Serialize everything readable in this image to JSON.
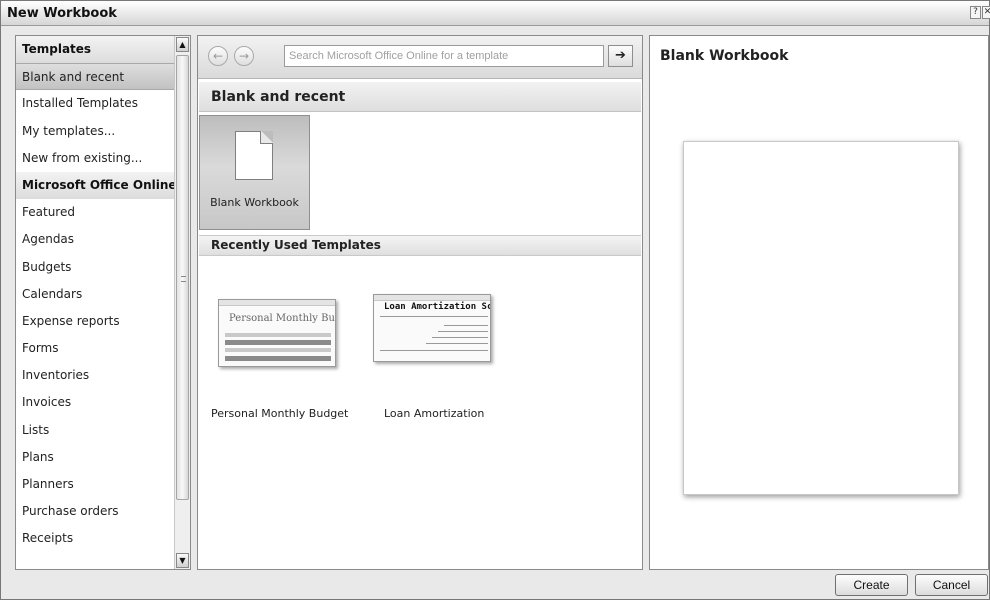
{
  "window": {
    "title": "New Workbook",
    "help_glyph": "?",
    "close_glyph": "✕"
  },
  "sidebar": {
    "items": [
      {
        "label": "Templates",
        "kind": "header"
      },
      {
        "label": "Blank and recent",
        "kind": "item",
        "selected": true
      },
      {
        "label": "Installed Templates",
        "kind": "item"
      },
      {
        "label": "My templates...",
        "kind": "item"
      },
      {
        "label": "New from existing...",
        "kind": "item"
      },
      {
        "label": "Microsoft Office Online",
        "kind": "header"
      },
      {
        "label": "Featured",
        "kind": "item"
      },
      {
        "label": "Agendas",
        "kind": "item"
      },
      {
        "label": "Budgets",
        "kind": "item"
      },
      {
        "label": "Calendars",
        "kind": "item"
      },
      {
        "label": "Expense reports",
        "kind": "item"
      },
      {
        "label": "Forms",
        "kind": "item"
      },
      {
        "label": "Inventories",
        "kind": "item"
      },
      {
        "label": "Invoices",
        "kind": "item"
      },
      {
        "label": "Lists",
        "kind": "item"
      },
      {
        "label": "Plans",
        "kind": "item"
      },
      {
        "label": "Planners",
        "kind": "item"
      },
      {
        "label": "Purchase orders",
        "kind": "item"
      },
      {
        "label": "Receipts",
        "kind": "item"
      }
    ],
    "scroll_up_glyph": "▲",
    "scroll_down_glyph": "▼"
  },
  "search": {
    "back_glyph": "←",
    "forward_glyph": "→",
    "placeholder": "Search Microsoft Office Online for a template",
    "go_glyph": "➔"
  },
  "main": {
    "section_title": "Blank and recent",
    "blank_tile_label": "Blank Workbook",
    "recent_title": "Recently Used Templates",
    "recent_templates": [
      {
        "label": "Personal Monthly Budget",
        "thumb_heading": "Personal Monthly Bu"
      },
      {
        "label": "Loan Amortization",
        "thumb_heading": "Loan Amortization Sche"
      }
    ]
  },
  "preview": {
    "title": "Blank Workbook"
  },
  "footer": {
    "create_label": "Create",
    "cancel_label": "Cancel"
  },
  "icons": {
    "back": "back-arrow-icon",
    "forward": "forward-arrow-icon",
    "search_go": "go-arrow-icon",
    "blank_doc": "blank-document-icon"
  }
}
